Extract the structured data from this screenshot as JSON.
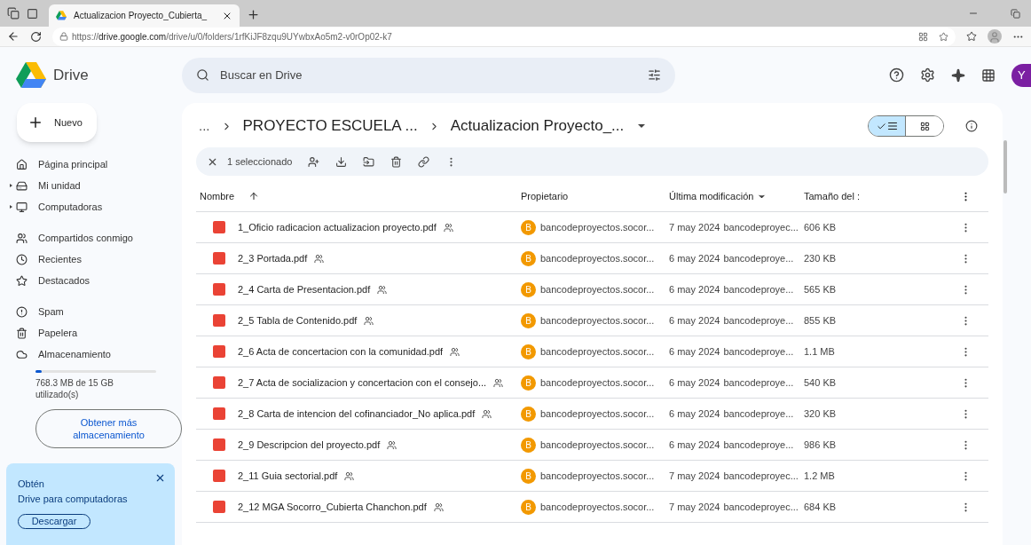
{
  "browser": {
    "tab_title": "Actualizacion Proyecto_Cubierta_",
    "url_prefix": "https://",
    "url_domain": "drive.google.com",
    "url_path": "/drive/u/0/folders/1rfKiJF8zqu9UYwbxAo5m2-v0rOp02-k7"
  },
  "app": {
    "name": "Drive",
    "search_placeholder": "Buscar en Drive",
    "avatar": "Y"
  },
  "sidebar": {
    "new_button": "Nuevo",
    "groups": [
      [
        {
          "label": "Página principal",
          "expandable": false
        },
        {
          "label": "Mi unidad",
          "expandable": true
        },
        {
          "label": "Computadoras",
          "expandable": true
        }
      ],
      [
        {
          "label": "Compartidos conmigo",
          "expandable": false
        },
        {
          "label": "Recientes",
          "expandable": false
        },
        {
          "label": "Destacados",
          "expandable": false
        }
      ],
      [
        {
          "label": "Spam",
          "expandable": false
        },
        {
          "label": "Papelera",
          "expandable": false
        },
        {
          "label": "Almacenamiento",
          "expandable": false
        }
      ]
    ],
    "storage": {
      "level": 0.05,
      "text": "768.3 MB de 15 GB utilizado(s)",
      "button": "Obtener más almacenamiento"
    },
    "promo": {
      "title": "Obtén",
      "subtitle": "Drive para computadoras",
      "button": "Descargar"
    }
  },
  "breadcrumb": {
    "overflow": "...",
    "items": [
      "PROYECTO ESCUELA ...",
      "Actualizacion Proyecto_..."
    ]
  },
  "view_toggle": {
    "list_selected": true
  },
  "selection_bar": {
    "text": "1 seleccionado"
  },
  "table": {
    "columns": [
      "Nombre",
      "Propietario",
      "Última modificación",
      "Tamaño del :"
    ],
    "rows": [
      {
        "name": "1_Oficio radicacion actualizacion proyecto.pdf",
        "owner_initial": "B",
        "owner": "bancodeproyectos.socor...",
        "date": "7 may 2024",
        "modified_by": "bancodeproyec...",
        "size": "606 KB"
      },
      {
        "name": "2_3 Portada.pdf",
        "owner_initial": "B",
        "owner": "bancodeproyectos.socor...",
        "date": "6 may 2024",
        "modified_by": "bancodeproye...",
        "size": "230 KB"
      },
      {
        "name": "2_4 Carta de Presentacion.pdf",
        "owner_initial": "B",
        "owner": "bancodeproyectos.socor...",
        "date": "6 may 2024",
        "modified_by": "bancodeproye...",
        "size": "565 KB"
      },
      {
        "name": "2_5 Tabla de Contenido.pdf",
        "owner_initial": "B",
        "owner": "bancodeproyectos.socor...",
        "date": "6 may 2024",
        "modified_by": "bancodeproye...",
        "size": "855 KB"
      },
      {
        "name": "2_6 Acta de concertacion con la comunidad.pdf",
        "owner_initial": "B",
        "owner": "bancodeproyectos.socor...",
        "date": "6 may 2024",
        "modified_by": "bancodeproye...",
        "size": "1.1 MB"
      },
      {
        "name": "2_7 Acta de socializacion y concertacion con el consejo...",
        "owner_initial": "B",
        "owner": "bancodeproyectos.socor...",
        "date": "6 may 2024",
        "modified_by": "bancodeproye...",
        "size": "540 KB"
      },
      {
        "name": "2_8 Carta de intencion del cofinanciador_No aplica.pdf",
        "owner_initial": "B",
        "owner": "bancodeproyectos.socor...",
        "date": "6 may 2024",
        "modified_by": "bancodeproye...",
        "size": "320 KB"
      },
      {
        "name": "2_9 Descripcion del proyecto.pdf",
        "owner_initial": "B",
        "owner": "bancodeproyectos.socor...",
        "date": "6 may 2024",
        "modified_by": "bancodeproye...",
        "size": "986 KB"
      },
      {
        "name": "2_11 Guia sectorial.pdf",
        "owner_initial": "B",
        "owner": "bancodeproyectos.socor...",
        "date": "7 may 2024",
        "modified_by": "bancodeproyec...",
        "size": "1.2 MB"
      },
      {
        "name": "2_12 MGA Socorro_Cubierta Chanchon.pdf",
        "owner_initial": "B",
        "owner": "bancodeproyectos.socor...",
        "date": "7 may 2024",
        "modified_by": "bancodeproyec...",
        "size": "684 KB"
      }
    ]
  }
}
